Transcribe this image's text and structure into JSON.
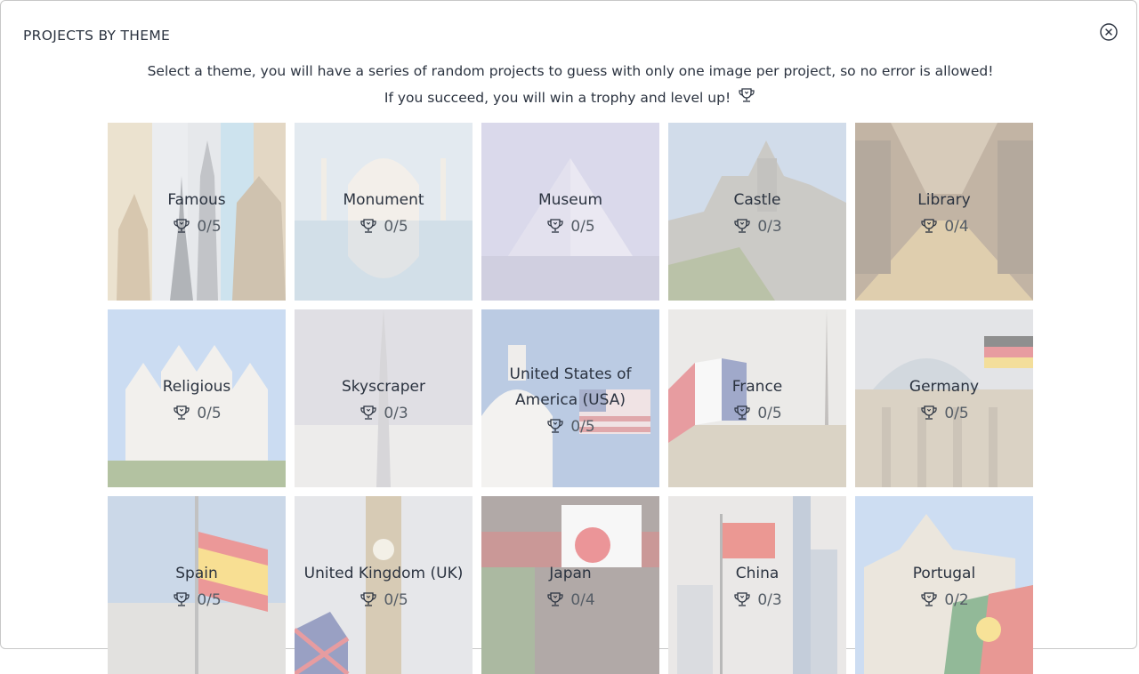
{
  "modal": {
    "title": "PROJECTS BY THEME",
    "close_icon": "close-circle-icon"
  },
  "intro": {
    "line1": "Select a theme, you will have a series of random projects to guess with only one image per project, so no error is allowed!",
    "line2": "If you succeed, you will win a trophy and level up!",
    "icon": "trophy-icon"
  },
  "themes": [
    {
      "name": "Famous",
      "score": "0/5"
    },
    {
      "name": "Monument",
      "score": "0/5"
    },
    {
      "name": "Museum",
      "score": "0/5"
    },
    {
      "name": "Castle",
      "score": "0/3"
    },
    {
      "name": "Library",
      "score": "0/4"
    },
    {
      "name": "Religious",
      "score": "0/5"
    },
    {
      "name": "Skyscraper",
      "score": "0/3"
    },
    {
      "name": "United States of America (USA)",
      "score": "0/5"
    },
    {
      "name": "France",
      "score": "0/5"
    },
    {
      "name": "Germany",
      "score": "0/5"
    },
    {
      "name": "Spain",
      "score": "0/5"
    },
    {
      "name": "United Kingdom (UK)",
      "score": "0/5"
    },
    {
      "name": "Japan",
      "score": "0/4"
    },
    {
      "name": "China",
      "score": "0/3"
    },
    {
      "name": "Portugal",
      "score": "0/2"
    }
  ]
}
